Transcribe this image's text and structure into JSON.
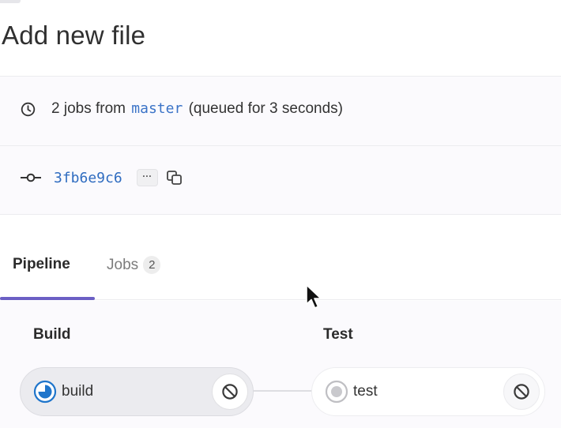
{
  "page": {
    "title": "Add new file"
  },
  "pipeline_info": {
    "icon": "clock-icon",
    "status_prefix": "2 jobs from",
    "branch": "master",
    "status_suffix": "(queued for 3 seconds)",
    "commit_icon": "commit-icon",
    "commit_sha": "3fb6e9c6",
    "expand_label": "···",
    "copy_icon": "copy-icon"
  },
  "tabs": [
    {
      "label": "Pipeline",
      "active": true
    },
    {
      "label": "Jobs",
      "count": "2",
      "active": false
    }
  ],
  "stages": [
    {
      "title": "Build",
      "jobs": [
        {
          "name": "build",
          "status": "running",
          "status_icon": "running-status-icon",
          "action_icon": "cancel-icon"
        }
      ]
    },
    {
      "title": "Test",
      "jobs": [
        {
          "name": "test",
          "status": "created",
          "status_icon": "created-status-icon",
          "action_icon": "cancel-icon"
        }
      ]
    }
  ],
  "colors": {
    "link": "#3b73c7",
    "tab_underline": "#6b5fc4",
    "running": "#1f75cb",
    "created": "#bfbfc3"
  }
}
